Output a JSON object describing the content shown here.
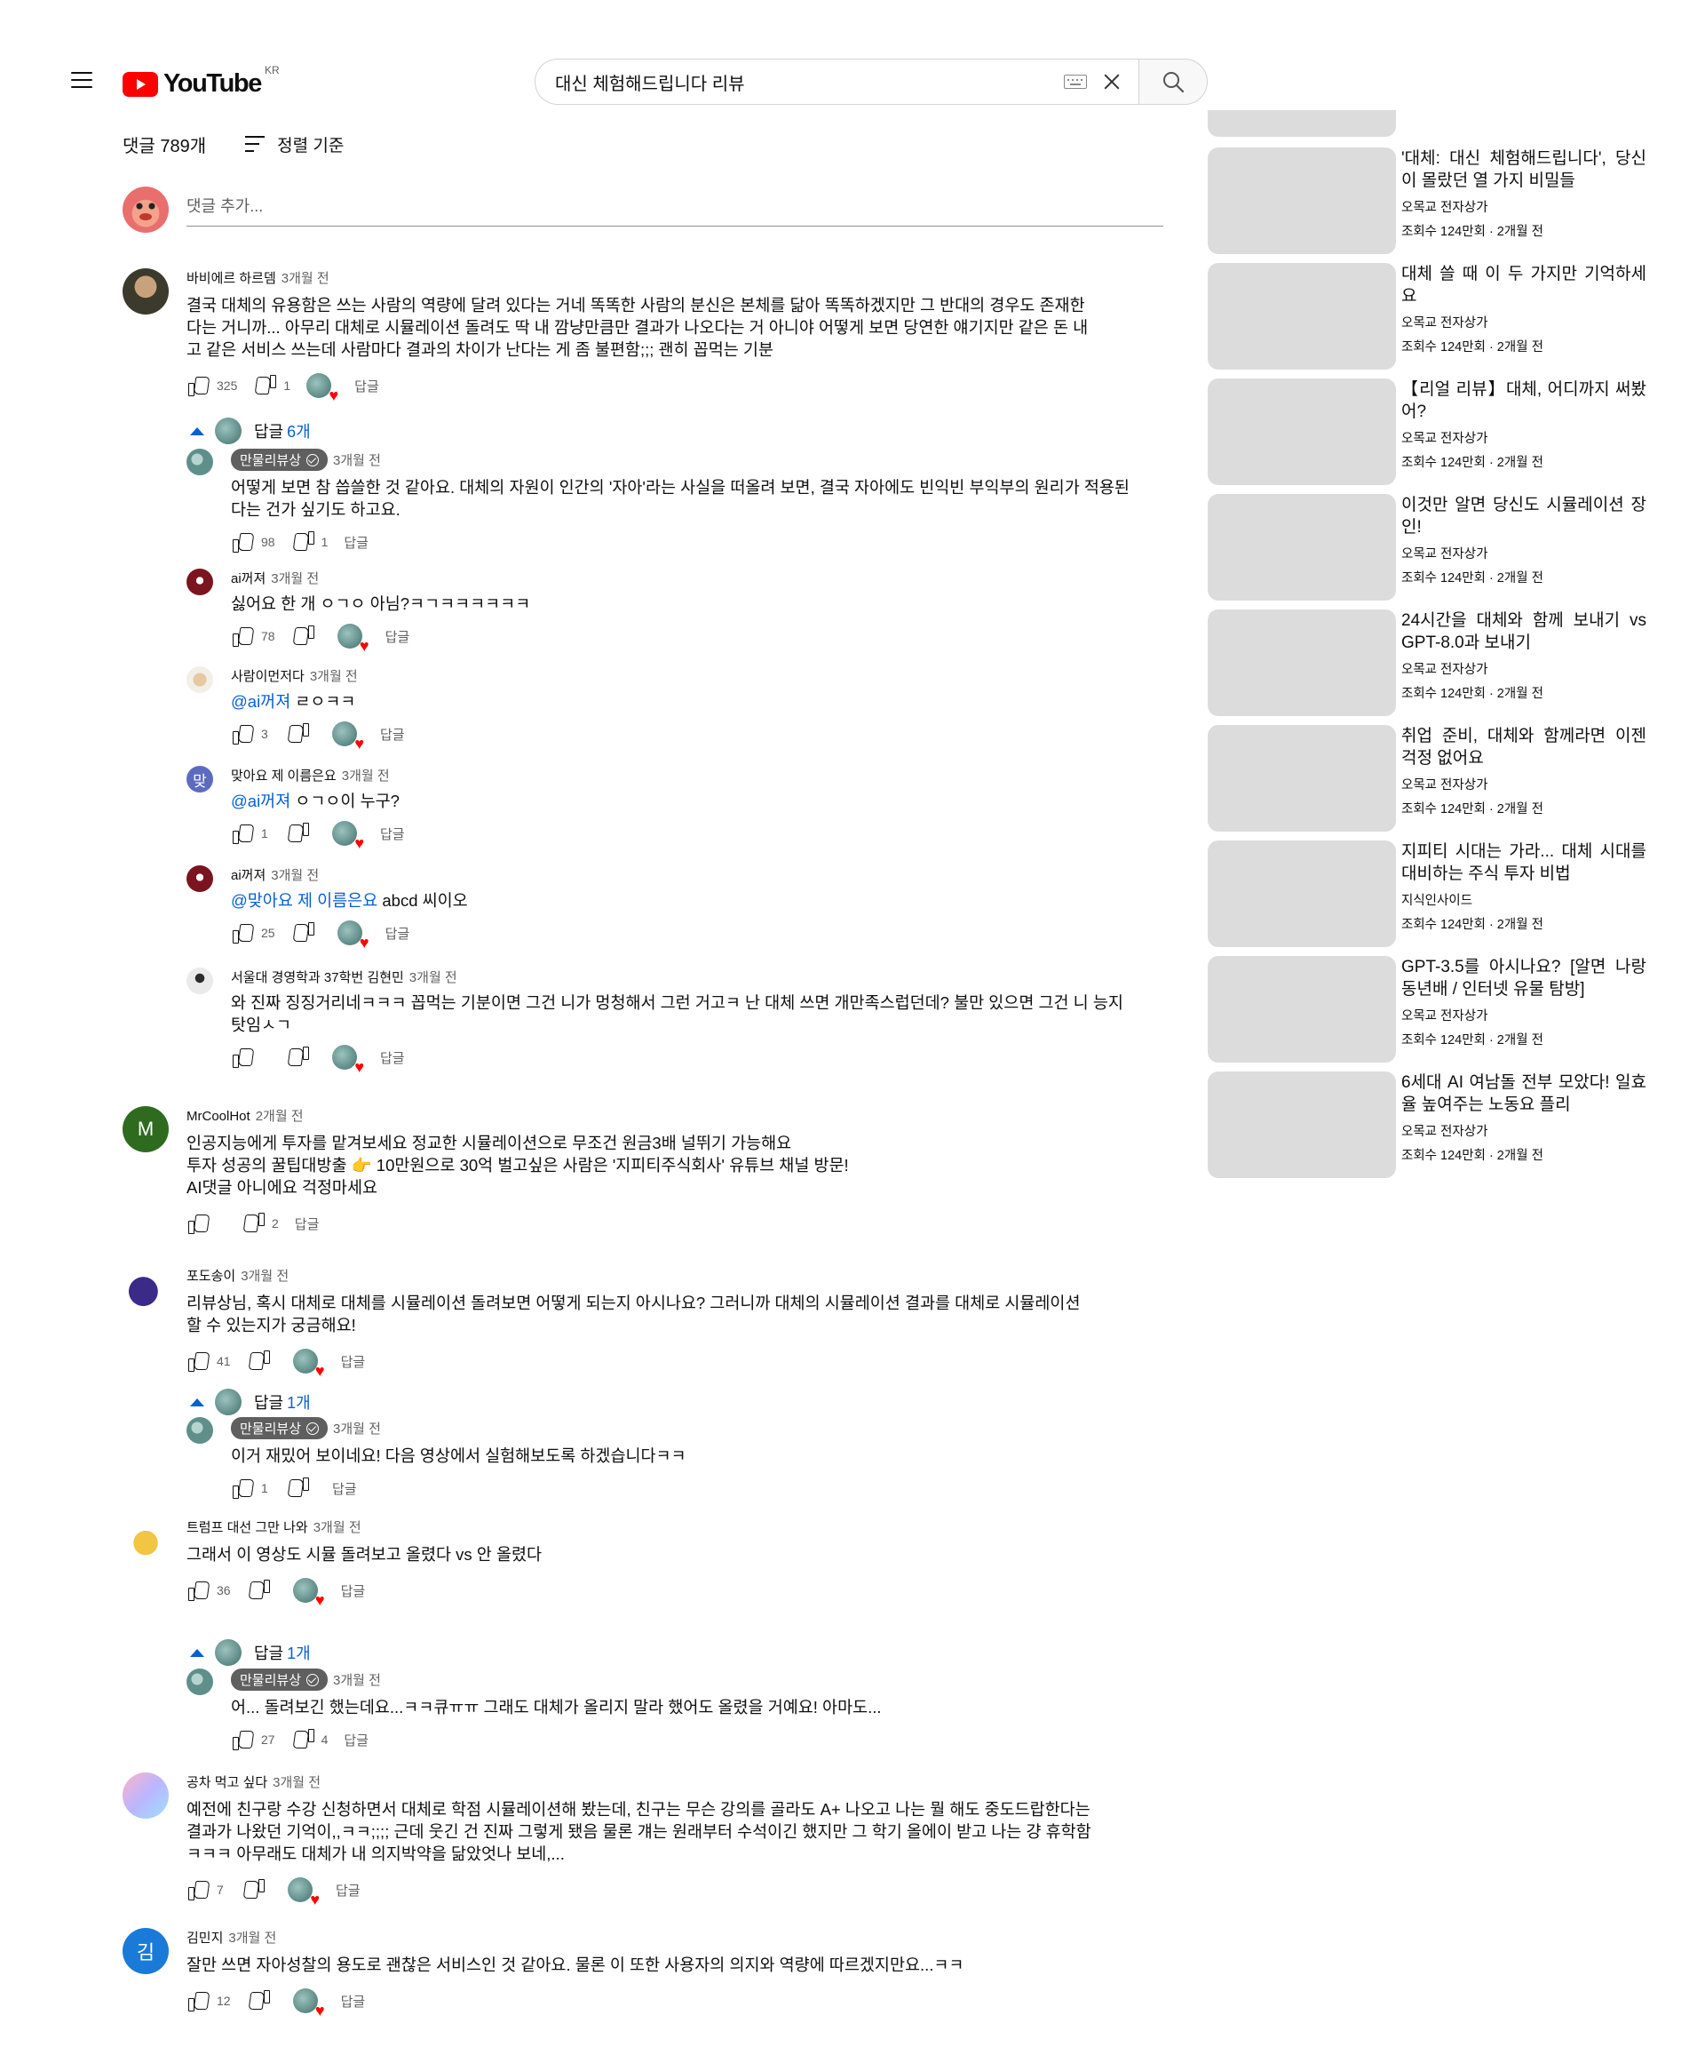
{
  "masthead": {
    "logo_text": "YouTube",
    "region": "KR",
    "search_value": "대신 체험해드립니다 리뷰"
  },
  "comments_header": {
    "count_label": "댓글 789개",
    "sort_label": "정렬 기준",
    "add_placeholder": "댓글 추가..."
  },
  "labels": {
    "reply": "답글"
  },
  "threads": [
    {
      "author": "바비에르 하르뎀",
      "time": "3개월 전",
      "text": [
        "결국 대체의 유용함은 쓰는 사람의 역량에 달려 있다는 거네 똑똑한 사람의 분신은 본체를 닮아 똑똑하겠지만 그 반대의 경우도 존재한",
        "다는 거니까... 아무리 대체로 시뮬레이션 돌려도 딱 내 깜냥만큼만 결과가 나오다는 거 아니야 어떻게 보면 당연한 얘기지만 같은 돈 내",
        "고 같은 서비스 쓰는데 사람마다 결과의 차이가 난다는 게 좀 불편함;;; 괜히 꼽먹는 기분"
      ],
      "likes": "325",
      "dislikes": "1",
      "replies_label": "답글",
      "replies_count": "6개",
      "replies": [
        {
          "author": "만물리뷰상",
          "owner": true,
          "time": "3개월 전",
          "text": [
            "어떻게 보면 참 씁쓸한 것 같아요. 대체의 자원이 인간의 '자아'라는 사실을 떠올려 보면, 결국 자아에도 빈익빈 부익부의 원리가 적용된",
            "다는 건가 싶기도 하고요."
          ],
          "likes": "98",
          "dislikes": "1"
        },
        {
          "author": "ai꺼져",
          "time": "3개월 전",
          "text": [
            "싫어요 한 개 ㅇㄱㅇ 아님?ㅋㄱㅋㅋㅋㅋㅋㅋ"
          ],
          "likes": "78"
        },
        {
          "author": "사람이먼저다",
          "time": "3개월 전",
          "mention": "@ai꺼져",
          "text": [
            " ㄹㅇㅋㅋ"
          ],
          "likes": "3"
        },
        {
          "author": "맞아요 제 이름은요",
          "time": "3개월 전",
          "mention": "@ai꺼져",
          "text": [
            " ㅇㄱㅇ이 누구?"
          ],
          "likes": "1",
          "avatar_letter": "맞"
        },
        {
          "author": "ai꺼져",
          "time": "3개월 전",
          "mention": "@맞아요 제 이름은요",
          "text": [
            " abcd 씨이오"
          ],
          "likes": "25"
        },
        {
          "author": "서울대 경영학과 37학번 김현민",
          "time": "3개월 전",
          "text": [
            "와 진짜 징징거리네ㅋㅋㅋ 꼽먹는 기분이면 그건 니가 멍청해서 그런 거고ㅋ 난 대체 쓰면 개만족스럽던데? 불만 있으면 그건 니 능지",
            "탓임ㅅㄱ"
          ],
          "likes": ""
        }
      ]
    },
    {
      "author": "MrCoolHot",
      "time": "2개월 전",
      "avatar_letter": "M",
      "text": [
        "인공지능에게 투자를 맡겨보세요 정교한 시뮬레이션으로 무조건 원금3배 널뛰기 가능해요",
        "투자 성공의 꿀팁대방출 👉 10만원으로 30억 벌고싶은 사람은 '지피티주식회사' 유튜브 채널 방문!",
        "AI댓글 아니에요 걱정마세요"
      ],
      "likes": "",
      "dislikes": "2"
    },
    {
      "author": "포도송이",
      "time": "3개월 전",
      "text": [
        "리뷰상님, 혹시 대체로 대체를 시뮬레이션 돌려보면 어떻게 되는지 아시나요? 그러니까 대체의 시뮬레이션 결과를 대체로 시뮬레이션",
        "할 수 있는지가 궁금해요!"
      ],
      "likes": "41",
      "replies_label": "답글",
      "replies_count": "1개",
      "replies": [
        {
          "author": "만물리뷰상",
          "owner": true,
          "time": "3개월 전",
          "text": [
            "이거 재밌어 보이네요! 다음 영상에서 실험해보도록 하겠습니다ㅋㅋ"
          ],
          "likes": "1"
        }
      ]
    },
    {
      "author": "트럼프 대선 그만 나와",
      "time": "3개월 전",
      "text": [
        "그래서 이 영상도 시뮬 돌려보고 올렸다 vs 안 올렸다"
      ],
      "likes": "36",
      "replies_label": "답글",
      "replies_count": "1개",
      "replies": [
        {
          "author": "만물리뷰상",
          "owner": true,
          "time": "3개월 전",
          "text": [
            "어... 돌려보긴 했는데요...ㅋㅋ큐ㅠㅠ 그래도 대체가 올리지 말라 했어도 올렸을 거예요! 아마도..."
          ],
          "likes": "27",
          "dislikes": "4"
        }
      ]
    },
    {
      "author": "공차 먹고 싶다",
      "time": "3개월 전",
      "text": [
        "예전에 친구랑 수강 신청하면서 대체로 학점 시뮬레이션해 봤는데, 친구는 무슨 강의를 골라도 A+ 나오고 나는 뭘 해도 중도드랍한다는",
        "결과가 나왔던 기억이,,ㅋㅋ;;;; 근데 웃긴 건 진짜 그렇게 됐음 물론 걔는 원래부터 수석이긴 했지만 그 학기 올에이 받고 나는 걍 휴학함",
        "ㅋㅋㅋ 아무래도 대체가 내 의지박약을 닮았엇나 보네,..."
      ],
      "likes": "7"
    },
    {
      "author": "김민지",
      "time": "3개월 전",
      "avatar_letter": "김",
      "text": [
        "잘만 쓰면 자아성찰의 용도로 괜찮은 서비스인 것 같아요. 물론 이 또한 사용자의 의지와 역량에 따르겠지만요...ㅋㅋ"
      ],
      "likes": "12"
    }
  ],
  "sidebar": [
    {
      "title": "'대체: 대신 체험해드립니다', 당신이 몰랐던 열 가지 비밀들",
      "channel": "오목교 전자상가",
      "views": "조회수 124만회 · 2개월 전"
    },
    {
      "title": "대체 쓸 때 이 두 가지만 기억하세요",
      "channel": "오목교 전자상가",
      "views": "조회수 124만회 · 2개월 전"
    },
    {
      "title": "【리얼 리뷰】대체, 어디까지 써봤어?",
      "channel": "오목교 전자상가",
      "views": "조회수 124만회 · 2개월 전"
    },
    {
      "title": "이것만 알면 당신도 시뮬레이션 장인!",
      "channel": "오목교 전자상가",
      "views": "조회수 124만회 · 2개월 전"
    },
    {
      "title": "24시간을 대체와 함께 보내기 vs GPT-8.0과 보내기",
      "channel": "오목교 전자상가",
      "views": "조회수 124만회 · 2개월 전"
    },
    {
      "title": "취업 준비, 대체와 함께라면 이젠 걱정 없어요",
      "channel": "오목교 전자상가",
      "views": "조회수 124만회 · 2개월 전"
    },
    {
      "title": "지피티 시대는 가라... 대체 시대를 대비하는 주식 투자 비법",
      "channel": "지식인사이드",
      "views": "조회수 124만회 · 2개월 전"
    },
    {
      "title": "GPT-3.5를 아시나요? [알면 나랑 동년배 / 인터넷 유물 탐방]",
      "channel": "오목교 전자상가",
      "views": "조회수 124만회 · 2개월 전"
    },
    {
      "title": "6세대 AI 여남돌 전부 모았다! 일효율 높여주는 노동요 플리",
      "channel": "오목교 전자상가",
      "views": "조회수 124만회 · 2개월 전"
    }
  ],
  "colors": {
    "brand_red": "#ff0000",
    "link_blue": "#065fd4",
    "owner_chip": "#5f5f5f"
  }
}
